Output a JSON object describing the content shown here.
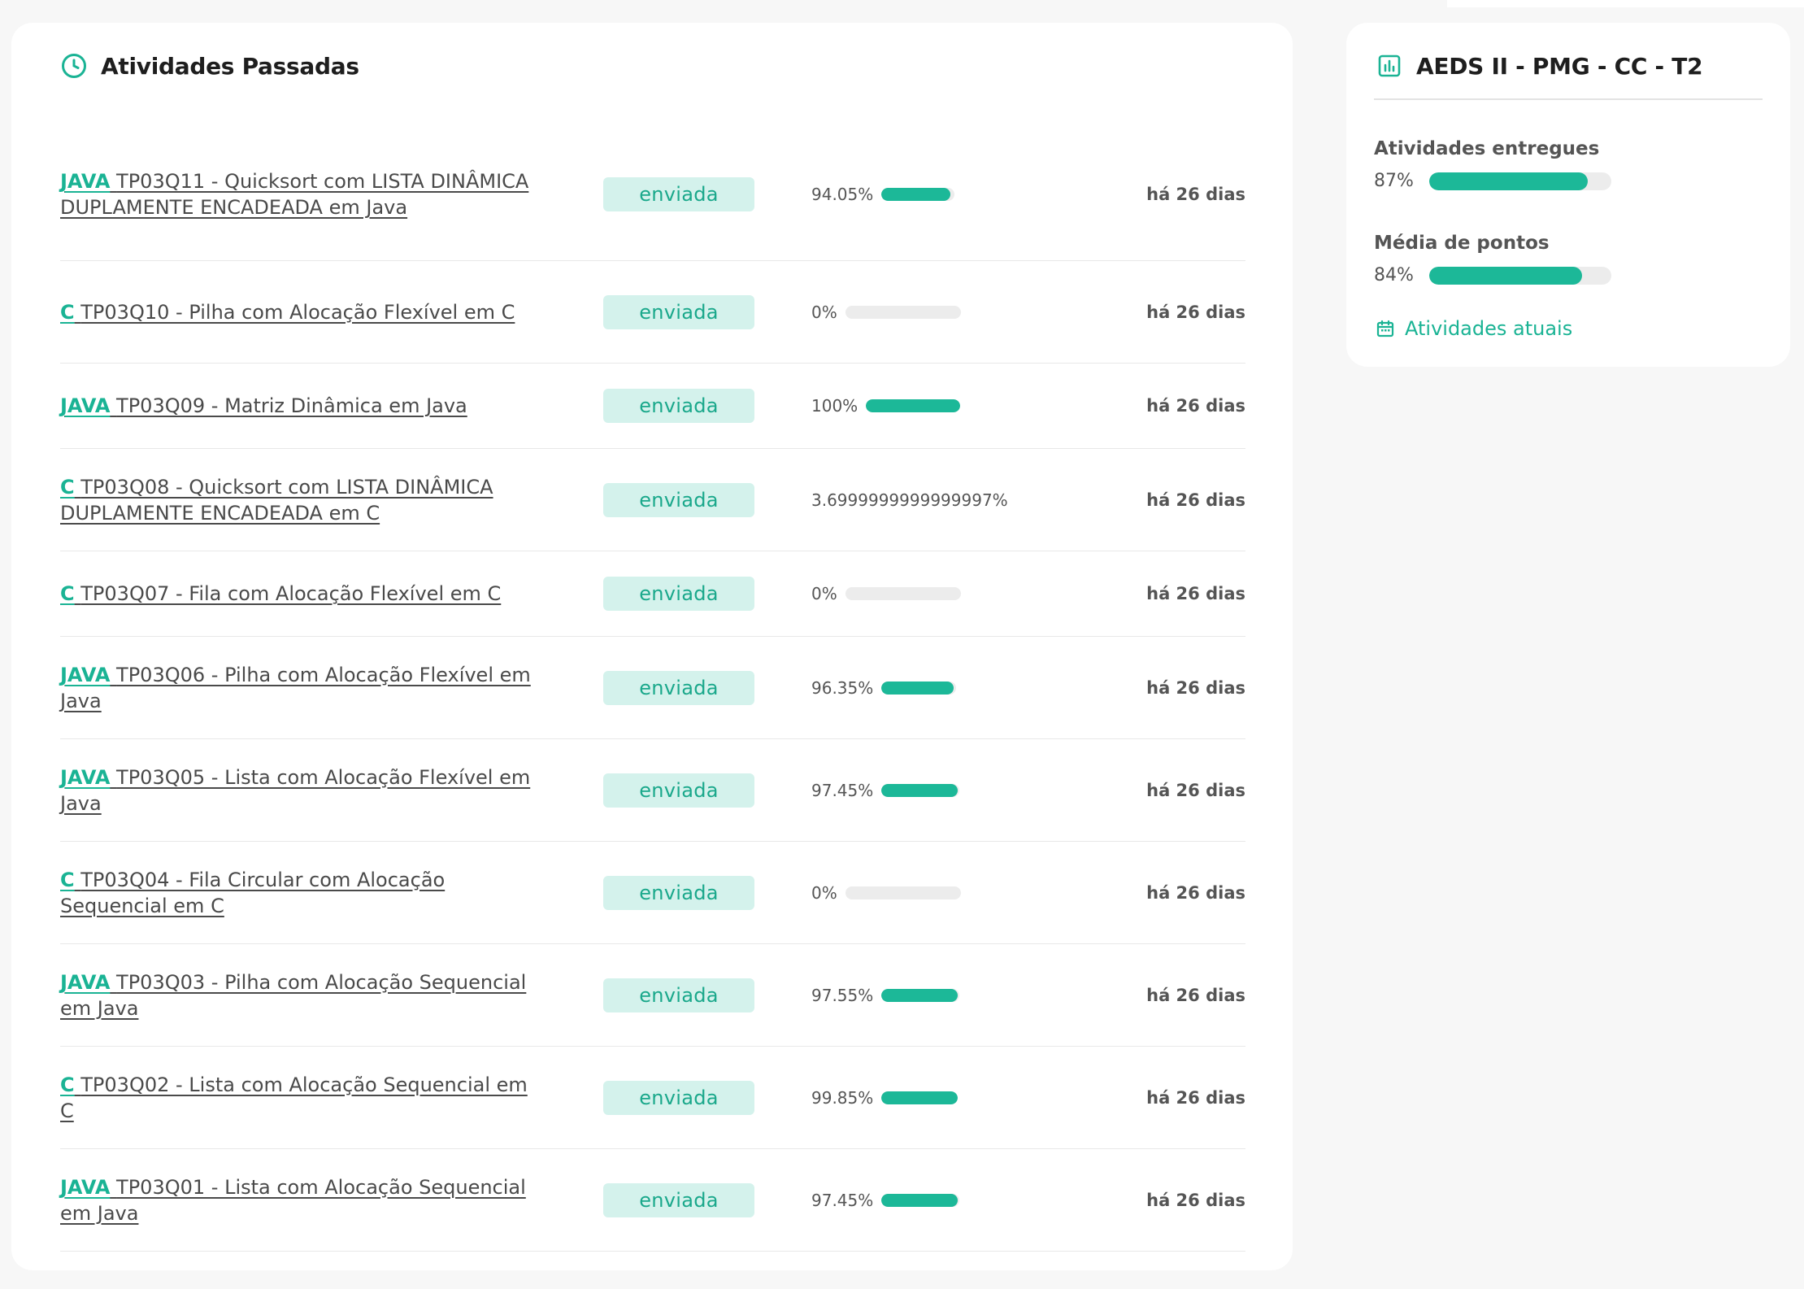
{
  "colors": {
    "accent": "#1ab394",
    "badge_bg": "#d4f2ec",
    "bar_fill": "#1cb898",
    "bar_track": "#ececec"
  },
  "past": {
    "title": "Atividades Passadas",
    "icon": "clock-icon",
    "rows": [
      {
        "lang": "JAVA",
        "title": "TP03Q11 - Quicksort com LISTA DINÂMICA DUPLAMENTE ENCADEADA em Java",
        "status": "enviada",
        "score_label": "94.05%",
        "score": 94.05,
        "date": "há 26 dias"
      },
      {
        "lang": "C",
        "title": "TP03Q10 - Pilha com Alocação Flexível em C",
        "status": "enviada",
        "score_label": "0%",
        "score": 0,
        "date": "há 26 dias"
      },
      {
        "lang": "JAVA",
        "title": "TP03Q09 - Matriz Dinâmica em Java",
        "status": "enviada",
        "score_label": "100%",
        "score": 100,
        "date": "há 26 dias"
      },
      {
        "lang": "C",
        "title": "TP03Q08 - Quicksort com LISTA DINÂMICA DUPLAMENTE ENCADEADA em C",
        "status": "enviada",
        "score_label": "3.6999999999999997%",
        "score": null,
        "date": "há 26 dias"
      },
      {
        "lang": "C",
        "title": "TP03Q07 - Fila com Alocação Flexível em C",
        "status": "enviada",
        "score_label": "0%",
        "score": 0,
        "date": "há 26 dias"
      },
      {
        "lang": "JAVA",
        "title": "TP03Q06 - Pilha com Alocação Flexível em Java",
        "status": "enviada",
        "score_label": "96.35%",
        "score": 96.35,
        "date": "há 26 dias"
      },
      {
        "lang": "JAVA",
        "title": "TP03Q05 - Lista com Alocação Flexível em Java",
        "status": "enviada",
        "score_label": "97.45%",
        "score": 97.45,
        "date": "há 26 dias"
      },
      {
        "lang": "C",
        "title": "TP03Q04 - Fila Circular com Alocação Sequencial em C",
        "status": "enviada",
        "score_label": "0%",
        "score": 0,
        "date": "há 26 dias"
      },
      {
        "lang": "JAVA",
        "title": "TP03Q03 - Pilha com Alocação Sequencial em Java",
        "status": "enviada",
        "score_label": "97.55%",
        "score": 97.55,
        "date": "há 26 dias"
      },
      {
        "lang": "C",
        "title": "TP03Q02 - Lista com Alocação Sequencial em C",
        "status": "enviada",
        "score_label": "99.85%",
        "score": 99.85,
        "date": "há 26 dias"
      },
      {
        "lang": "JAVA",
        "title": "TP03Q01 - Lista com Alocação Sequencial em Java",
        "status": "enviada",
        "score_label": "97.45%",
        "score": 97.45,
        "date": "há 26 dias"
      }
    ]
  },
  "course": {
    "title": "AEDS II - PMG - CC - T2",
    "icon": "bar-chart-icon",
    "delivered": {
      "label": "Atividades entregues",
      "value_label": "87%",
      "value": 87
    },
    "average": {
      "label": "Média de pontos",
      "value_label": "84%",
      "value": 84
    },
    "current_link": {
      "label": "Atividades atuais",
      "icon": "calendar-icon"
    }
  }
}
